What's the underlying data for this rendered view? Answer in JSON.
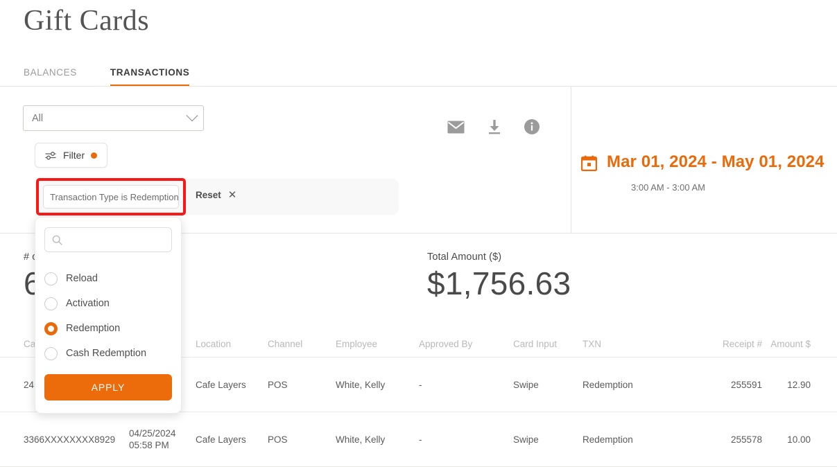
{
  "page": {
    "title": "Gift Cards"
  },
  "tabs": [
    {
      "label": "BALANCES",
      "active": false
    },
    {
      "label": "TRANSACTIONS",
      "active": true
    }
  ],
  "controls": {
    "scope_select": {
      "value": "All",
      "icon": "chevron-down-icon"
    },
    "filter_button": {
      "label": "Filter",
      "icon": "filter-sliders-icon",
      "badge": "dot"
    },
    "filter_chip": {
      "label": "Transaction Type is Redemption"
    },
    "reset": {
      "label": "Reset",
      "icon": "close-icon"
    },
    "icons": [
      {
        "name": "email-icon",
        "title": "Email"
      },
      {
        "name": "download-icon",
        "title": "Download"
      },
      {
        "name": "info-icon",
        "title": "Info"
      }
    ]
  },
  "date_range": {
    "icon": "calendar-icon",
    "range": "Mar 01, 2024 - May 01, 2024",
    "time": "3:00 AM - 3:00 AM",
    "color": "#ea6a0a"
  },
  "kpis": [
    {
      "label": "# o",
      "value": "6"
    },
    {
      "label": "Total Amount ($)",
      "value": "$1,756.63"
    }
  ],
  "type_dropdown": {
    "search_placeholder": "",
    "search_value": "",
    "search_icon": "search-icon",
    "options": [
      {
        "label": "Reload",
        "selected": false
      },
      {
        "label": "Activation",
        "selected": false
      },
      {
        "label": "Redemption",
        "selected": true
      },
      {
        "label": "Cash Redemption",
        "selected": false
      }
    ],
    "apply_label": "APPLY"
  },
  "table": {
    "headers": {
      "card": "Ca",
      "datetime": "",
      "location": "Location",
      "channel": "Channel",
      "employee": "Employee",
      "approved_by": "Approved By",
      "card_input": "Card Input",
      "txn": "TXN",
      "receipt": "Receipt #",
      "amount": "Amount $"
    },
    "rows": [
      {
        "card": "24",
        "date": "",
        "time": "",
        "location": "Cafe Layers",
        "channel": "POS",
        "employee": "White, Kelly",
        "approved_by": "-",
        "card_input": "Swipe",
        "txn": "Redemption",
        "receipt": "255591",
        "amount": "12.90"
      },
      {
        "card": "3366XXXXXXXX8929",
        "date": "04/25/2024",
        "time": "05:58 PM",
        "location": "Cafe Layers",
        "channel": "POS",
        "employee": "White, Kelly",
        "approved_by": "-",
        "card_input": "Swipe",
        "txn": "Redemption",
        "receipt": "255578",
        "amount": "10.00"
      }
    ]
  },
  "annotation": {
    "highlight_color": "#f81818",
    "target": "filter-chip"
  },
  "theme": {
    "accent": "#ea6a0a",
    "text": "#4a4a4a",
    "muted": "#b9b9b9",
    "divider": "#e6e4e0"
  }
}
